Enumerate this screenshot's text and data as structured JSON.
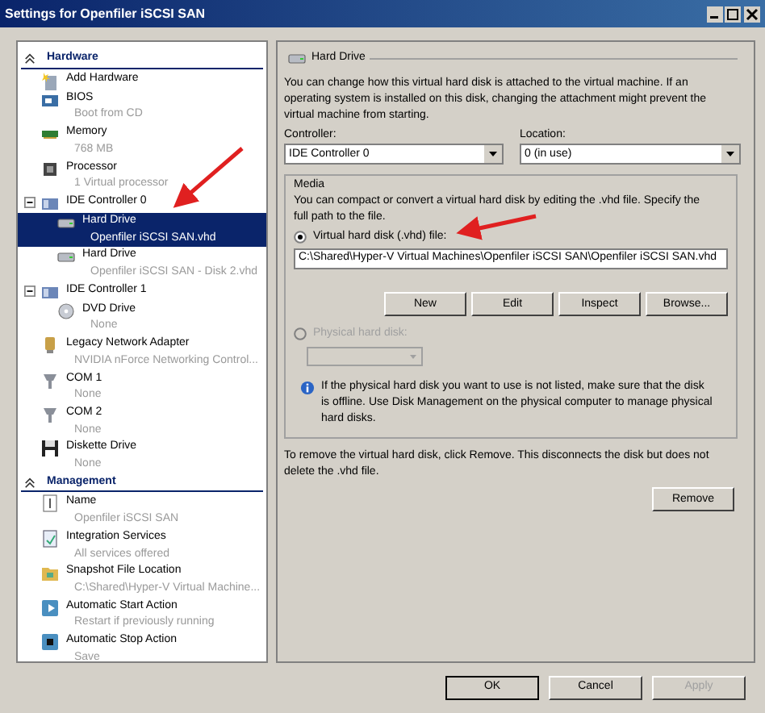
{
  "window": {
    "title": "Settings for Openfiler iSCSI SAN"
  },
  "tree": [
    {
      "title": "Hardware",
      "expanded": true,
      "items": [
        {
          "kind": "add",
          "label": "Add Hardware",
          "selected": false
        },
        {
          "kind": "bios",
          "label": "BIOS",
          "detail": "Boot from CD",
          "selected": false
        },
        {
          "kind": "memory",
          "label": "Memory",
          "detail": "768 MB",
          "selected": false
        },
        {
          "kind": "processor",
          "label": "Processor",
          "detail": "1 Virtual processor",
          "selected": false
        },
        {
          "kind": "controller",
          "label": "IDE Controller 0",
          "expanded": true,
          "selected": false,
          "children": [
            {
              "kind": "harddisk",
              "label": "Hard Drive",
              "detail": "Openfiler iSCSI SAN.vhd",
              "selected": true
            },
            {
              "kind": "harddisk",
              "label": "Hard Drive",
              "detail": "Openfiler iSCSI SAN - Disk 2.vhd",
              "selected": false
            }
          ]
        },
        {
          "kind": "controller",
          "label": "IDE Controller 1",
          "expanded": true,
          "selected": false,
          "children": [
            {
              "kind": "dvd",
              "label": "DVD Drive",
              "detail": "None",
              "selected": false
            }
          ]
        },
        {
          "kind": "network",
          "label": "Legacy Network Adapter",
          "detail": "NVIDIA nForce Networking Control...",
          "selected": false
        },
        {
          "kind": "com",
          "label": "COM 1",
          "detail": "None",
          "selected": false
        },
        {
          "kind": "com",
          "label": "COM 2",
          "detail": "None",
          "selected": false
        },
        {
          "kind": "floppy",
          "label": "Diskette Drive",
          "detail": "None",
          "selected": false
        }
      ]
    },
    {
      "title": "Management",
      "expanded": true,
      "items": [
        {
          "kind": "name",
          "label": "Name",
          "detail": "Openfiler iSCSI SAN",
          "selected": false
        },
        {
          "kind": "integration",
          "label": "Integration Services",
          "detail": "All services offered",
          "selected": false
        },
        {
          "kind": "folder",
          "label": "Snapshot File Location",
          "detail": "C:\\Shared\\Hyper-V Virtual Machine...",
          "selected": false
        },
        {
          "kind": "start",
          "label": "Automatic Start Action",
          "detail": "Restart if previously running",
          "selected": false
        },
        {
          "kind": "stop",
          "label": "Automatic Stop Action",
          "detail": "Save",
          "selected": false
        }
      ]
    }
  ],
  "panel": {
    "title": "Hard Drive",
    "description": "You can change how this virtual hard disk is attached to the virtual machine. If an operating system is installed on this disk, changing the attachment might prevent the virtual machine from starting.",
    "controller": {
      "label": "Controller:",
      "value": "IDE Controller 0"
    },
    "location": {
      "label": "Location:",
      "value": "0 (in use)"
    },
    "media": {
      "title": "Media",
      "description": "You can compact or convert a virtual hard disk by editing the .vhd file. Specify the full path to the file.",
      "options": [
        {
          "label": "Virtual hard disk (.vhd) file:",
          "selected": true,
          "disabled": false
        },
        {
          "label": "Physical hard disk:",
          "selected": false,
          "disabled": true
        }
      ],
      "path": "C:\\Shared\\Hyper-V Virtual Machines\\Openfiler iSCSI SAN\\Openfiler iSCSI SAN.vhd",
      "buttons": [
        "New",
        "Edit",
        "Inspect",
        "Browse..."
      ],
      "info": "If the physical hard disk you want to use is not listed, make sure that the disk is offline. Use Disk Management on the physical computer to manage physical hard disks."
    },
    "remove_text": "To remove the virtual hard disk, click Remove. This disconnects the disk but does not delete the .vhd file.",
    "remove_button": "Remove"
  },
  "buttons": [
    {
      "label": "OK",
      "disabled": false
    },
    {
      "label": "Cancel",
      "disabled": false
    },
    {
      "label": "Apply",
      "disabled": true
    }
  ]
}
